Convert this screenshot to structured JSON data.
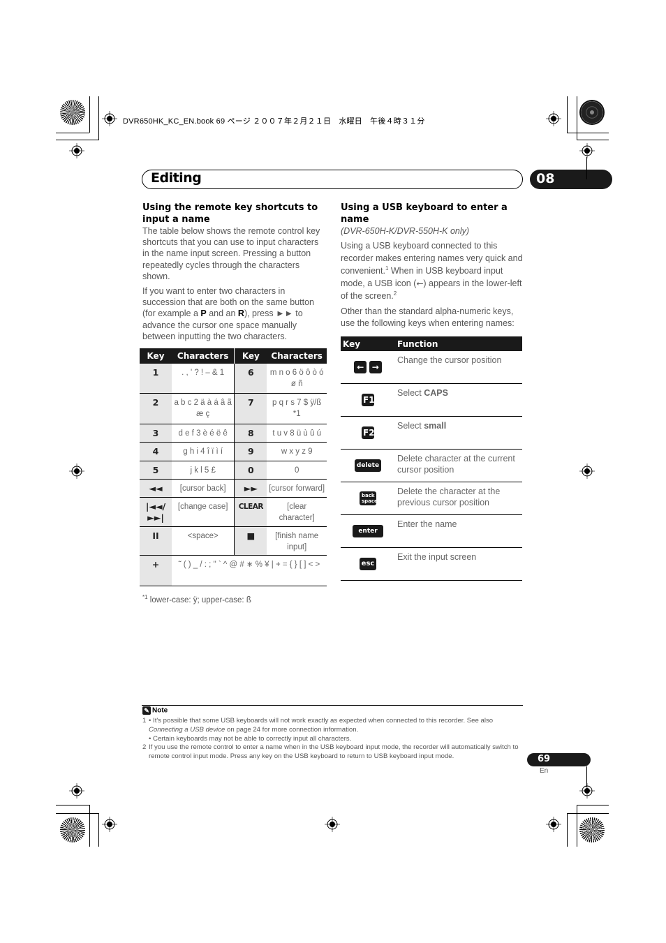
{
  "print_header": "DVR650HK_KC_EN.book  69 ページ  ２００７年２月２１日　水曜日　午後４時３１分",
  "section": {
    "title": "Editing",
    "chapter": "08"
  },
  "left": {
    "heading": "Using the remote key shortcuts to input a name",
    "para1": "The table below shows the remote control key shortcuts that you can use to input characters in the name input screen. Pressing a button repeatedly cycles through the characters shown.",
    "para2_a": "If you want to enter two characters in succession that are both on the same button (for example a ",
    "para2_p": "P",
    "para2_b": " and an ",
    "para2_r": "R",
    "para2_c": "), press ►► to advance the cursor one space manually between inputting the two characters."
  },
  "key_table": {
    "headers": [
      "Key",
      "Characters",
      "Key",
      "Characters"
    ],
    "rows": [
      {
        "k1": "1",
        "c1": ". , ' ? ! – & 1",
        "k2": "6",
        "c2": "m n o 6 ö ô ò ó ø ñ"
      },
      {
        "k1": "2",
        "c1": "a b c 2 ä à á â ã æ ç",
        "k2": "7",
        "c2": "p q r s 7 $ ÿ/ß *1"
      },
      {
        "k1": "3",
        "c1": "d e f 3 è é ë ê",
        "k2": "8",
        "c2": "t u v 8 ü ù û ú"
      },
      {
        "k1": "4",
        "c1": "g h i 4 î ï ì í",
        "k2": "9",
        "c2": "w x y z 9"
      },
      {
        "k1": "5",
        "c1": "j k l 5 £",
        "k2": "0",
        "c2": "0"
      },
      {
        "k1": "◄◄",
        "c1": "[cursor back]",
        "k2": "►►",
        "c2": "[cursor forward]"
      },
      {
        "k1": "|◄◄/ ►►|",
        "c1": "[change case]",
        "k2": "CLEAR",
        "c2": "[clear character]"
      },
      {
        "k1": "II",
        "c1": "<space>",
        "k2": "■",
        "c2": "[finish name input]"
      }
    ],
    "last_row": {
      "k": "+",
      "c": "˜ ( ) _ / : ; \" ` ^ @ # ∗ % ¥ | + = { } [ ] < >"
    }
  },
  "footnote": {
    "mark": "*1",
    "text": "lower-case: ÿ; upper-case: ß"
  },
  "right": {
    "heading": "Using a USB keyboard to enter a name",
    "models": "(DVR-650H-K/DVR-550H-K only)",
    "para1_a": "Using a USB keyboard connected to this recorder makes entering names very quick and convenient.",
    "para1_sup1": "1",
    "para1_b": " When in USB keyboard input mode, a USB icon (⭠) appears in the lower-left of the screen.",
    "para1_sup2": "2",
    "para2": "Other than the standard alpha-numeric keys, use the following keys when entering names:"
  },
  "func_table": {
    "headers": [
      "Key",
      "Function"
    ],
    "rows": [
      {
        "key": [
          "←",
          "→"
        ],
        "key_icon": "arrow-keys-icon",
        "fn": "Change the cursor position",
        "bold": ""
      },
      {
        "key": [
          "F1"
        ],
        "key_icon": "f1-key-icon",
        "fn": "Select ",
        "bold": "CAPS"
      },
      {
        "key": [
          "F2"
        ],
        "key_icon": "f2-key-icon",
        "fn": "Select ",
        "bold": "small"
      },
      {
        "key": [
          "delete"
        ],
        "key_icon": "delete-key-icon",
        "fn": "Delete character at the current cursor position",
        "bold": ""
      },
      {
        "key": [
          "back space"
        ],
        "key_icon": "backspace-key-icon",
        "fn": "Delete the character at the previous cursor position",
        "bold": ""
      },
      {
        "key": [
          "enter"
        ],
        "key_icon": "enter-key-icon",
        "fn": "Enter the name",
        "bold": ""
      },
      {
        "key": [
          "esc"
        ],
        "key_icon": "esc-key-icon",
        "fn": "Exit the input screen",
        "bold": ""
      }
    ]
  },
  "note": {
    "title": "Note",
    "items": [
      {
        "num": "1",
        "text_a": "• It's possible that some USB keyboards will not work exactly as expected when connected to this recorder. See also ",
        "italic": "Connecting a USB device",
        "text_b": " on page 24 for more connection information."
      },
      {
        "num": "",
        "text_a": "• Certain keyboards may not be able to correctly input all characters.",
        "italic": "",
        "text_b": ""
      },
      {
        "num": "2",
        "text_a": "If you use the remote control to enter a name when in the USB keyboard input mode, the recorder will automatically switch to remote control input mode. Press any key on the USB keyboard to return to USB keyboard input mode.",
        "italic": "",
        "text_b": ""
      }
    ]
  },
  "page": {
    "number": "69",
    "lang": "En"
  }
}
